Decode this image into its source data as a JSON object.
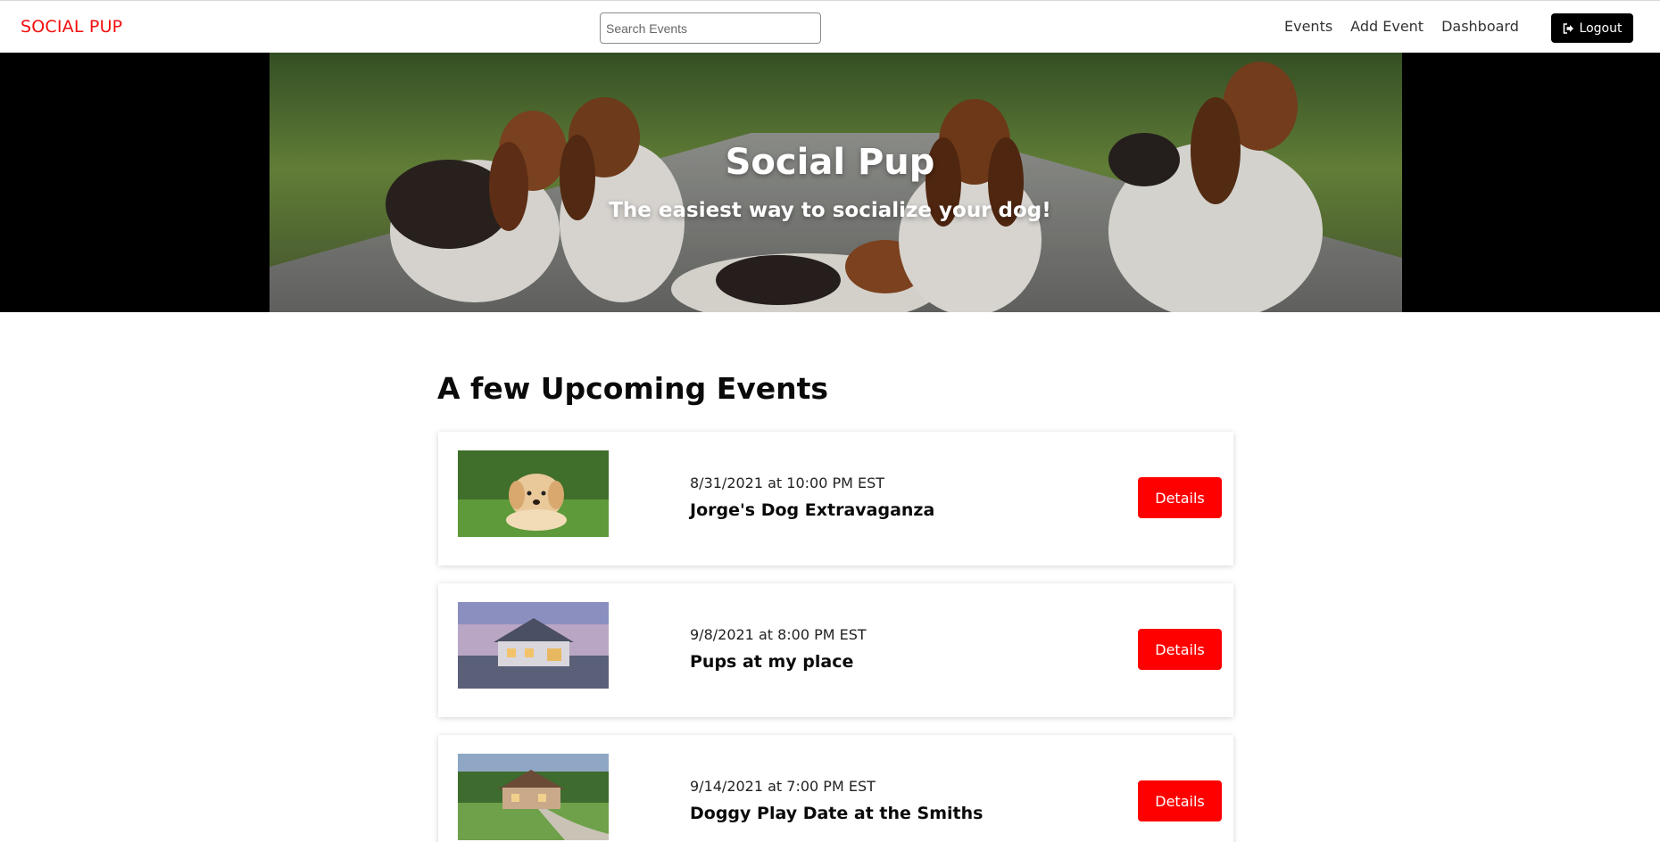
{
  "navbar": {
    "brand": "SOCIAL PUP",
    "search_placeholder": "Search Events",
    "links": [
      "Events",
      "Add Event",
      "Dashboard"
    ],
    "logout_label": "Logout",
    "logout_icon": "sign-out-icon"
  },
  "hero": {
    "title": "Social Pup",
    "subtitle": "The easiest way to socialize your dog!",
    "image": "basset-hounds-photo"
  },
  "events_section": {
    "title": "A few Upcoming Events",
    "events": [
      {
        "date": "8/31/2021 at 10:00 PM EST",
        "name": "Jorge's Dog Extravaganza",
        "image": "puppy-on-grass-photo",
        "button": "Details"
      },
      {
        "date": "9/8/2021 at 8:00 PM EST",
        "name": "Pups at my place",
        "image": "house-at-dusk-photo",
        "button": "Details"
      },
      {
        "date": "9/14/2021 at 7:00 PM EST",
        "name": "Doggy Play Date at the Smiths",
        "image": "house-with-lawn-photo",
        "button": "Details"
      }
    ]
  },
  "colors": {
    "brand_red": "#f20d0d",
    "button_red": "#ff0000",
    "logout_bg": "#000000"
  }
}
